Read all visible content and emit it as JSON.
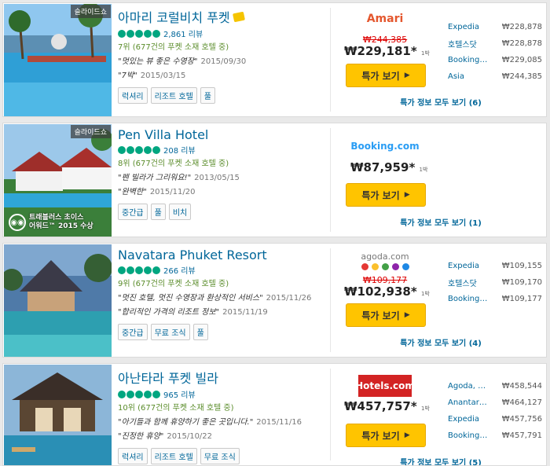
{
  "hotels": [
    {
      "slide_label": "슬라이드쇼",
      "name": "아마리 코럴비치 푸켓",
      "reviews": "2,861 리뷰",
      "rank": "7위 (677건의 푸켓 소재 호텔 중)",
      "quotes": [
        {
          "text": "\"멋있는 뷰 좋은 수영장\"",
          "date": "2015/09/30"
        },
        {
          "text": "\"7박\"",
          "date": "2015/03/15"
        }
      ],
      "tags": [
        "럭셔리",
        "리조트 호텔",
        "풀"
      ],
      "logo": "Amari",
      "old_price": "₩244,385",
      "price": "₩229,181",
      "per_night": "1박",
      "button": "특가 보기",
      "all_link": "특가 정보 모두 보기 (6)",
      "others": [
        {
          "site": "Expedia",
          "price": "₩228,878"
        },
        {
          "site": "호텔스닷",
          "price": "₩228,878"
        },
        {
          "site": "Booking…",
          "price": "₩229,085"
        },
        {
          "site": "Asia",
          "price": "₩244,385"
        }
      ]
    },
    {
      "slide_label": "슬라이드쇼",
      "name": "Pen Villa Hotel",
      "reviews": "208 리뷰",
      "rank": "8위 (677건의 푸켓 소재 호텔 중)",
      "quotes": [
        {
          "text": "\"펜 빌라가 그리워요!\"",
          "date": "2013/05/15"
        },
        {
          "text": "\"완벽한\"",
          "date": "2015/11/20"
        }
      ],
      "tags": [
        "중간급",
        "풀",
        "비치"
      ],
      "award_line1": "트래블러스 초이스",
      "award_line2": "어워드™ 2015 수상",
      "logo_a": "Booking",
      "logo_b": ".com",
      "price": "₩87,959",
      "per_night": "1박",
      "button": "특가 보기",
      "all_link": "특가 정보 모두 보기 (1)"
    },
    {
      "name": "Navatara Phuket Resort",
      "reviews": "266 리뷰",
      "rank": "9위 (677건의 푸켓 소재 호텔 중)",
      "quotes": [
        {
          "text": "\"멋진 호텔, 멋진 수영장과 환상적인 서비스\"",
          "date": "2015/11/26"
        },
        {
          "text": "\"합리적인 가격의 리조트 정보\"",
          "date": "2015/11/19"
        }
      ],
      "tags": [
        "중간급",
        "무료 조식",
        "풀"
      ],
      "logo": "agoda.com",
      "old_price": "₩109,177",
      "price": "₩102,938",
      "per_night": "1박",
      "button": "특가 보기",
      "all_link": "특가 정보 모두 보기 (4)",
      "others": [
        {
          "site": "Expedia",
          "price": "₩109,155"
        },
        {
          "site": "호텔스닷",
          "price": "₩109,170"
        },
        {
          "site": "Booking…",
          "price": "₩109,177"
        }
      ]
    },
    {
      "name": "아난타라 푸켓 빌라",
      "reviews": "965 리뷰",
      "rank": "10위 (677건의 푸켓 소재 호텔 중)",
      "quotes": [
        {
          "text": "\"아기들과 함께 휴양하기 좋은 곳입니다.\"",
          "date": "2015/11/16"
        },
        {
          "text": "\"진정한 휴양\"",
          "date": "2015/10/22"
        }
      ],
      "tags": [
        "럭셔리",
        "리조트 호텔",
        "무료 조식"
      ],
      "logo": "Hotels.com",
      "price": "₩457,757",
      "per_night": "1박",
      "button": "특가 보기",
      "all_link": "특가 정보 모두 보기 (5)",
      "others": [
        {
          "site": "Agoda, …",
          "price": "₩458,544"
        },
        {
          "site": "Anantar…",
          "price": "₩464,127"
        },
        {
          "site": "Expedia",
          "price": "₩457,756"
        },
        {
          "site": "Booking…",
          "price": "₩457,791"
        }
      ]
    }
  ],
  "colors": {
    "button": "#ffc400",
    "link": "#006699",
    "bubble": "#00a680",
    "strike": "#dd0000"
  }
}
